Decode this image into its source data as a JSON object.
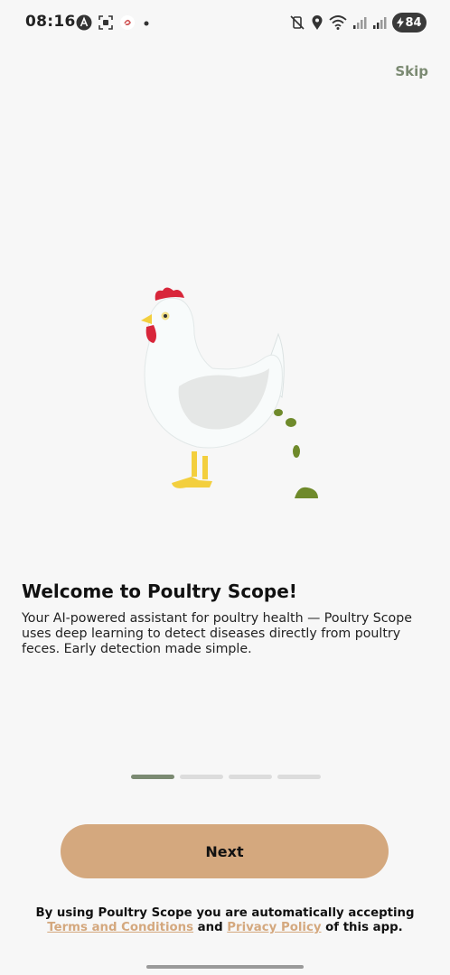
{
  "status_bar": {
    "time": "08:16",
    "battery": "84",
    "left_icons": [
      "accessibility-icon",
      "screenshot-icon",
      "app-notification-icon",
      "dot-icon"
    ],
    "right_icons": [
      "mute-vibrate-icon",
      "location-icon",
      "wifi-icon",
      "signal-icon",
      "signal-icon-2",
      "battery-charging-icon"
    ]
  },
  "onboarding": {
    "skip_label": "Skip",
    "title": "Welcome to Poultry Scope!",
    "description": "Your AI-powered assistant for poultry health — Poultry Scope uses deep learning to detect diseases directly from poultry feces. Early detection made simple.",
    "page_indicator": {
      "current": 1,
      "total": 4
    },
    "next_label": "Next"
  },
  "legal": {
    "prefix": "By using Poultry Scope you are automatically accepting",
    "terms_label": "Terms and Conditions",
    "and_text": "and",
    "privacy_label": "Privacy Policy",
    "suffix": "of this app."
  },
  "colors": {
    "background": "#f7f7f7",
    "accent_green": "#7b8a72",
    "button_tan": "#d4a87e",
    "pager_inactive": "#dcdcdc"
  }
}
